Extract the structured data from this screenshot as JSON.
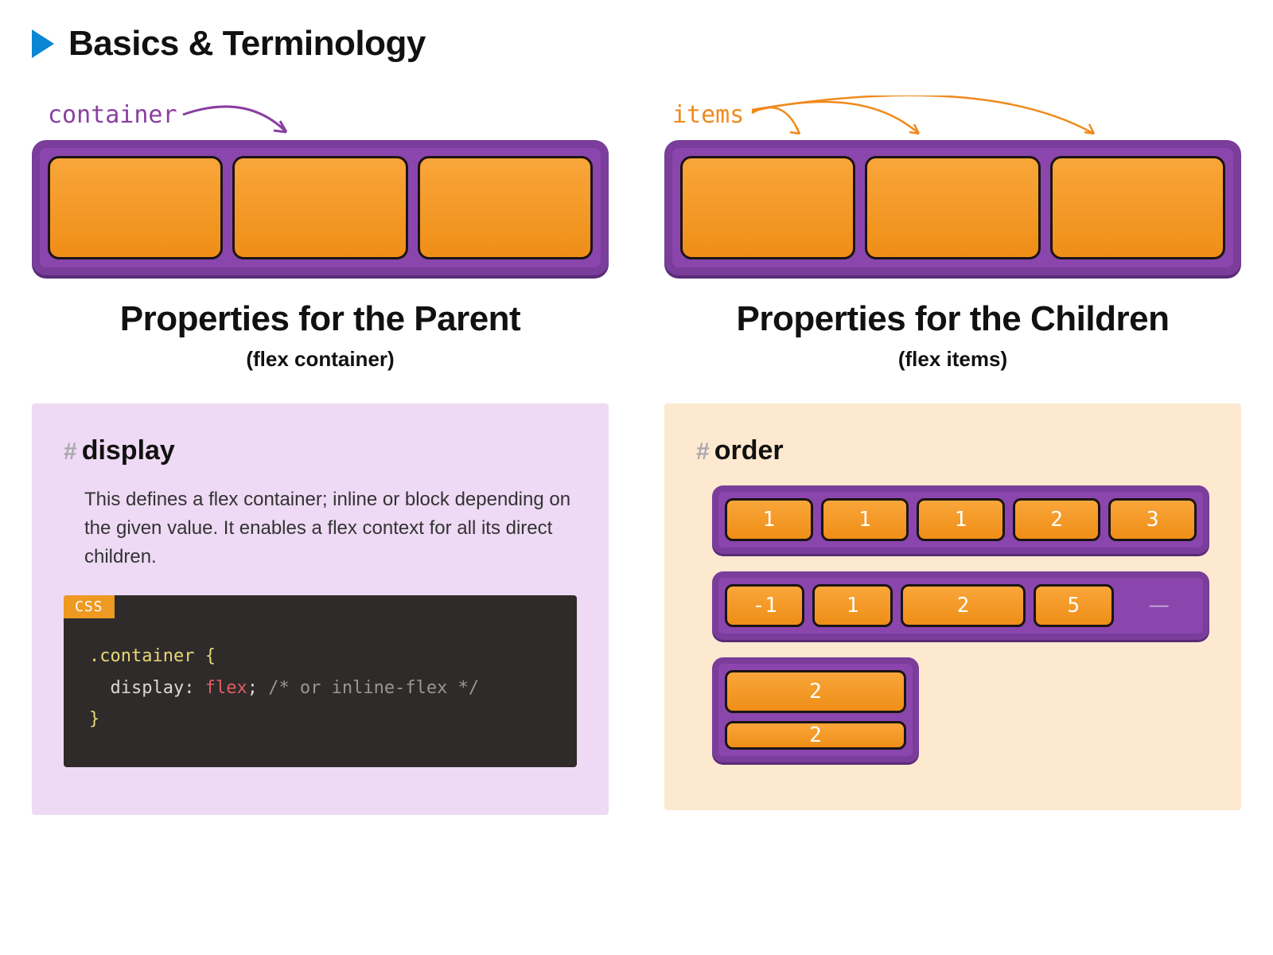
{
  "header": {
    "title": "Basics & Terminology"
  },
  "left": {
    "diagram_label": "container",
    "title": "Properties for the Parent",
    "subtitle": "(flex container)",
    "property": {
      "hash": "#",
      "name": "display",
      "description": "This defines a flex container; inline or block depending on the given value. It enables a flex context for all its direct children.",
      "code_lang": "CSS",
      "code_selector": ".container",
      "code_open": " {",
      "code_prop": "  display",
      "code_colon": ": ",
      "code_value": "flex",
      "code_semi": ";",
      "code_comment": " /* or inline-flex */",
      "code_close": "}"
    }
  },
  "right": {
    "diagram_label": "items",
    "title": "Properties for the Children",
    "subtitle": "(flex items)",
    "property": {
      "hash": "#",
      "name": "order",
      "rows": {
        "r1": {
          "a": "1",
          "b": "1",
          "c": "1",
          "d": "2",
          "e": "3"
        },
        "r2": {
          "a": "-1",
          "b": "1",
          "c": "2",
          "d": "5",
          "dash": "—"
        },
        "r3": {
          "a": "2",
          "b": "2"
        }
      }
    }
  },
  "colors": {
    "accent_blue": "#0b86d4",
    "purple": "#7a3d9b",
    "orange": "#ef8e17",
    "panel_parent": "#eedaf4",
    "panel_children": "#fde9cf"
  }
}
